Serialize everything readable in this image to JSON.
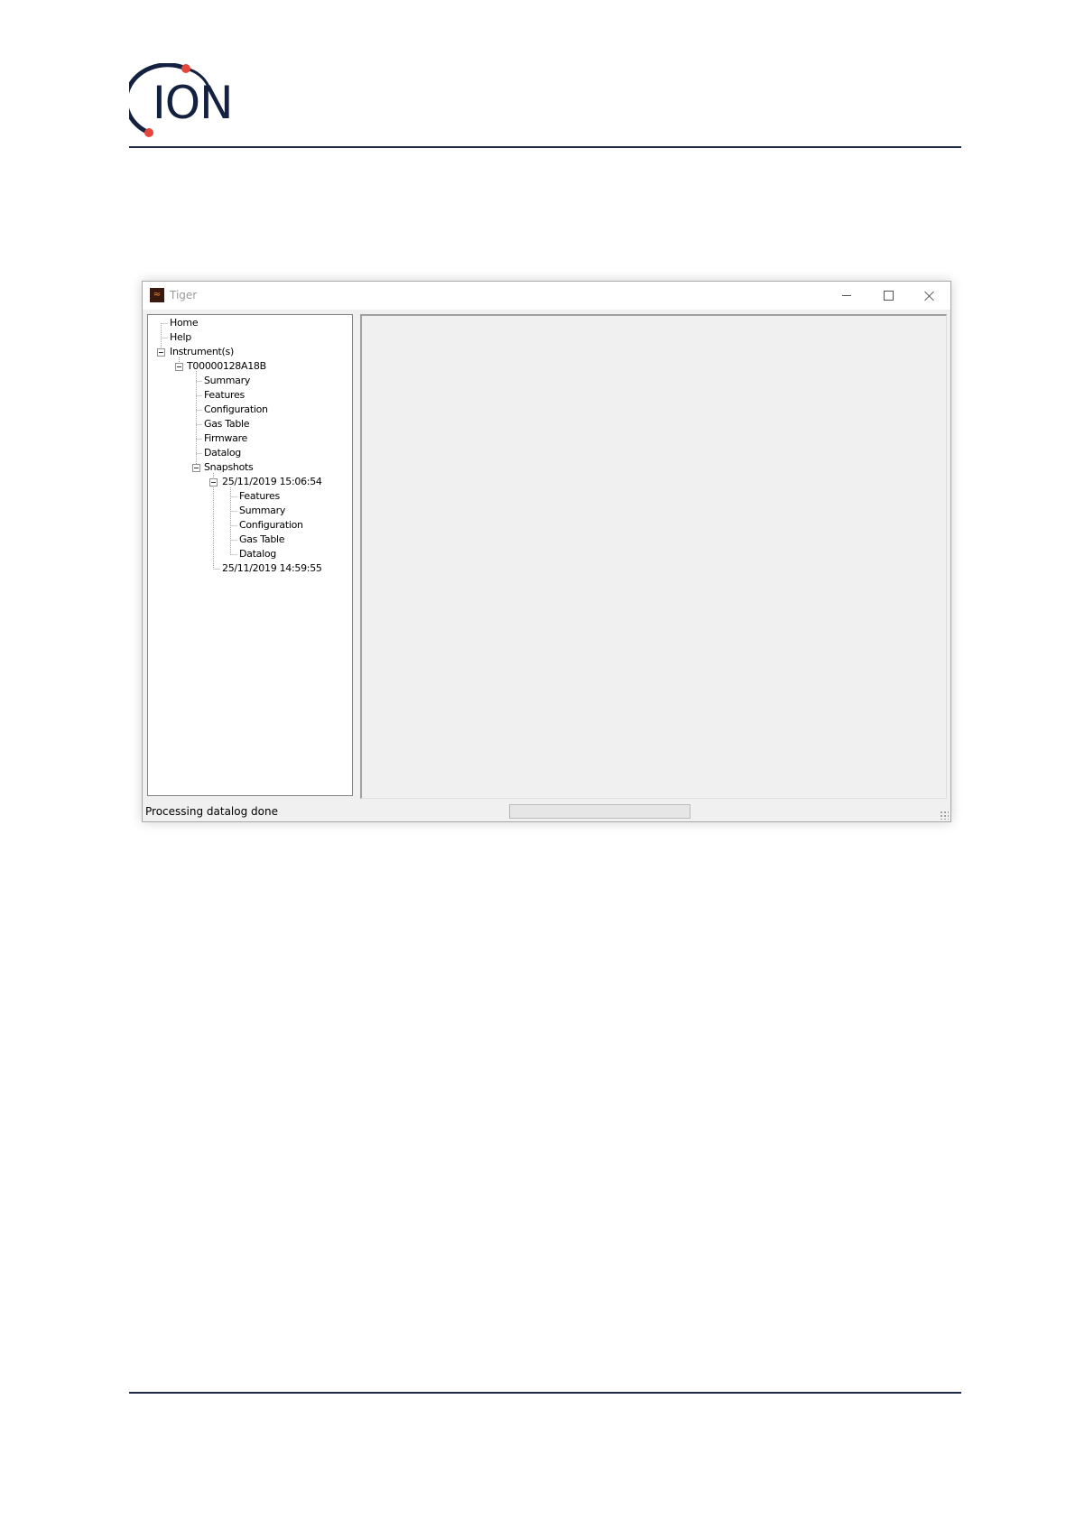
{
  "logo": {
    "text": "ION"
  },
  "window": {
    "title": "Tiger",
    "app_icon": "tiger-app-icon",
    "controls": {
      "minimize": "minimize-icon",
      "maximize": "maximize-icon",
      "close": "close-icon"
    }
  },
  "tree": {
    "home": "Home",
    "help": "Help",
    "instruments": "Instrument(s)",
    "instrument": "T00000128A18B",
    "summary": "Summary",
    "features": "Features",
    "configuration": "Configuration",
    "gas_table": "Gas Table",
    "firmware": "Firmware",
    "datalog": "Datalog",
    "snapshots": "Snapshots",
    "snapshot1": {
      "label": "25/11/2019 15:06:54",
      "features": "Features",
      "summary": "Summary",
      "configuration": "Configuration",
      "gas_table": "Gas Table",
      "datalog": "Datalog"
    },
    "snapshot2": {
      "label": "25/11/2019 14:59:55"
    }
  },
  "status": {
    "text": "Processing datalog done",
    "progress": 0
  },
  "colors": {
    "brand_navy": "#14203f",
    "brand_red": "#e5473c"
  }
}
